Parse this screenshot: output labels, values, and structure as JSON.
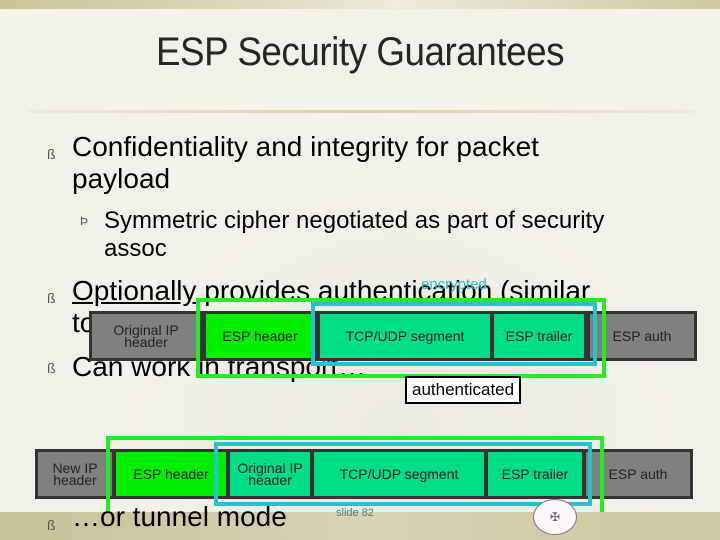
{
  "slide": {
    "title": "ESP Security Guarantees",
    "slide_number": "slide 82",
    "bullets": [
      {
        "marker": "ß",
        "text": "Confidentiality and integrity for packet payload",
        "line1": "Confidentiality and integrity for packet",
        "line2": "payload",
        "sub_bullets": [
          {
            "marker": "Þ",
            "line1": "Symmetric cipher negotiated as part of security",
            "line2": "assoc"
          }
        ]
      },
      {
        "marker": "ß",
        "underlined": "Optionally",
        "line1_rest": " provides authentication (similar",
        "line2": "to AH)"
      },
      {
        "marker": "ß",
        "line1": "Can work in transport…"
      },
      {
        "marker": "ß",
        "line1": "…or tunnel mode"
      }
    ]
  },
  "transport_diagram": {
    "cells": [
      {
        "label_line1": "Original IP",
        "label_line2": "header",
        "color": "#808080"
      },
      {
        "label": "ESP header",
        "color": "#00ee00"
      },
      {
        "label": "TCP/UDP segment",
        "color": "#00dd88"
      },
      {
        "label": "ESP trailer",
        "color": "#00dd88"
      },
      {
        "label": "ESP auth",
        "color": "#808080"
      }
    ],
    "encrypted_label": "encrypted",
    "authenticated_label": "authenticated"
  },
  "tunnel_diagram": {
    "cells": [
      {
        "label_line1": "New IP",
        "label_line2": "header",
        "color": "#808080"
      },
      {
        "label": "ESP header",
        "color": "#00ee00"
      },
      {
        "label_line1": "Original IP",
        "label_line2": "header",
        "color": "#00dd88"
      },
      {
        "label": "TCP/UDP segment",
        "color": "#00dd88"
      },
      {
        "label": "ESP trailer",
        "color": "#00dd88"
      },
      {
        "label": "ESP auth",
        "color": "#808080"
      }
    ]
  },
  "colors": {
    "authenticated_outline": "#22ee22",
    "encrypted_outline": "#22c4d0"
  },
  "icons": {
    "seal": "university-seal-icon"
  }
}
